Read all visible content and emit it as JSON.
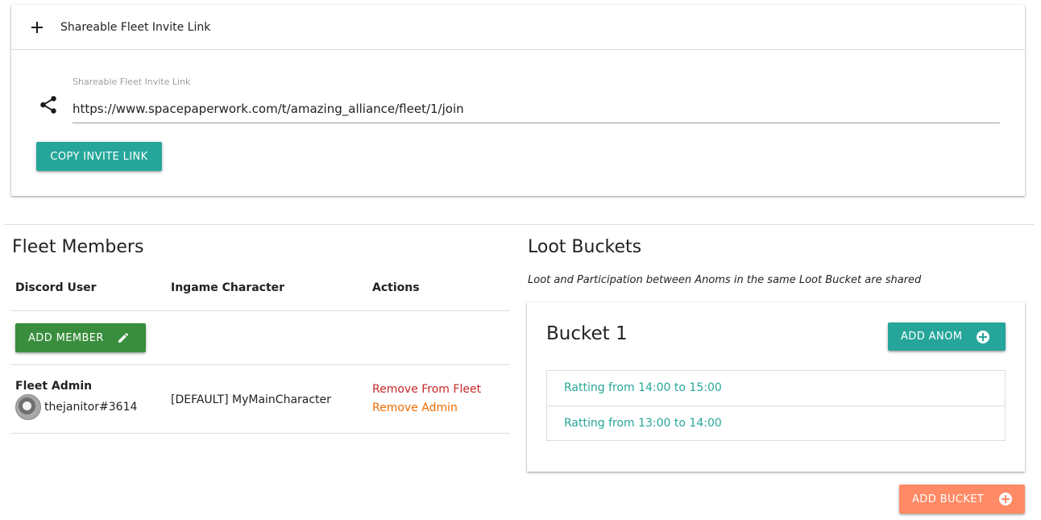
{
  "invite": {
    "header_title": "Shareable Fleet Invite Link",
    "field_label": "Shareable Fleet Invite Link",
    "link_value": "https://www.spacepaperwork.com/t/amazing_alliance/fleet/1/join",
    "copy_button": "COPY INVITE LINK",
    "icons": {
      "expand": "plus-icon",
      "share": "share-icon"
    }
  },
  "fleet_members": {
    "title": "Fleet Members",
    "columns": [
      "Discord User",
      "Ingame Character",
      "Actions"
    ],
    "add_member_button": "ADD MEMBER",
    "members": [
      {
        "role": "Fleet Admin",
        "discord_user": "thejanitor#3614",
        "character": "[DEFAULT] MyMainCharacter",
        "actions": [
          "Remove From Fleet",
          "Remove Admin"
        ]
      }
    ]
  },
  "loot_buckets": {
    "title": "Loot Buckets",
    "subtitle": "Loot and Participation between Anoms in the same Loot Bucket are shared",
    "buckets": [
      {
        "name": "Bucket 1",
        "add_anom_button": "ADD ANOM",
        "anoms": [
          "Ratting from 14:00 to 15:00",
          "Ratting from 13:00 to 14:00"
        ]
      }
    ],
    "add_bucket_button": "ADD BUCKET"
  },
  "colors": {
    "teal": "#26a69a",
    "green": "#388e3c",
    "orange_button": "#ff8a65",
    "remove_fleet_red": "#c62828",
    "remove_admin_orange": "#ef6c00"
  }
}
